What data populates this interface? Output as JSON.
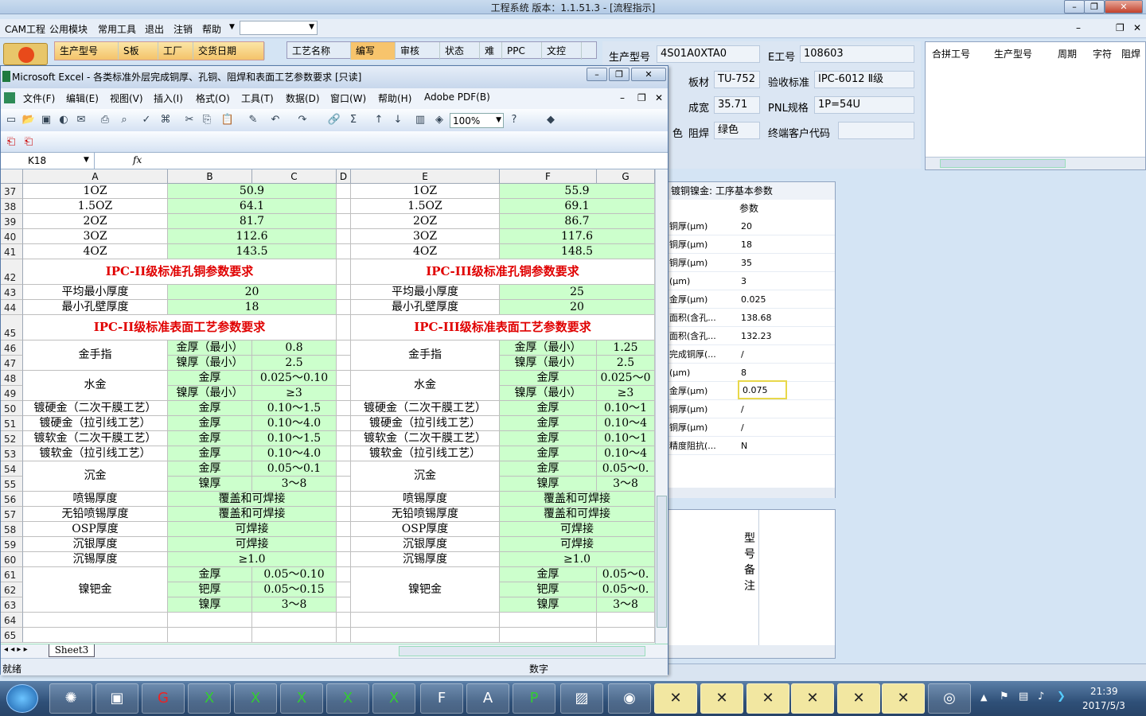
{
  "app": {
    "title": "工程系统   版本：1.1.51.3 - [流程指示]",
    "menu": [
      "CAM工程",
      "公用模块",
      "常用工具",
      "退出",
      "注销",
      "帮助"
    ],
    "tabs_left": [
      "生产型号",
      "S板",
      "工厂",
      "交货日期"
    ],
    "tabs_mid": [
      "工艺名称",
      "编写",
      "审核",
      "状态",
      "难",
      "PPC",
      "文控"
    ]
  },
  "info": {
    "prod_model_label": "生产型号",
    "prod_model": "4S01A0XTA0",
    "e_no_label": "E工号",
    "e_no": "108603",
    "board_label": "板材",
    "board": "TU-752",
    "accept_label": "验收标准",
    "accept": "IPC-6012 Ⅱ级",
    "finish_width_label": "成宽",
    "finish_width": "35.71",
    "pnl_label": "PNL规格",
    "pnl": "1P=54U",
    "color_label": "色",
    "solder_label": "阻焊",
    "solder": "绿色",
    "customer_label": "终端客户代码",
    "customer": ""
  },
  "combo_panel": {
    "headers": [
      "合拼工号",
      "生产型号",
      "周期",
      "字符",
      "阻焊"
    ]
  },
  "process_panel": {
    "title": "镀铜镍金: 工序基本参数",
    "param_header": "参数",
    "rows": [
      {
        "name": "铜厚(μm)",
        "value": "20"
      },
      {
        "name": "铜厚(μm)",
        "value": "18"
      },
      {
        "name": "铜厚(μm)",
        "value": "35"
      },
      {
        "name": "(μm)",
        "value": "3"
      },
      {
        "name": "金厚(μm)",
        "value": "0.025"
      },
      {
        "name": "面积(含孔...",
        "value": "138.68"
      },
      {
        "name": "面积(含孔...",
        "value": "132.23"
      },
      {
        "name": "完成铜厚(...",
        "value": "/"
      },
      {
        "name": "(μm)",
        "value": "8"
      },
      {
        "name": "金厚(μm)",
        "value": "0.075"
      },
      {
        "name": "铜厚(μm)",
        "value": "/"
      },
      {
        "name": "铜厚(μm)",
        "value": "/"
      },
      {
        "name": "精度阻抗(...",
        "value": "N"
      }
    ]
  },
  "remark": {
    "label": "型号备注"
  },
  "excel": {
    "title": "Microsoft Excel - 各类标准外层完成铜厚、孔铜、阻焊和表面工艺参数要求 [只读]",
    "menu": [
      "文件(F)",
      "编辑(E)",
      "视图(V)",
      "插入(I)",
      "格式(O)",
      "工具(T)",
      "数据(D)",
      "窗口(W)",
      "帮助(H)",
      "Adobe PDF(B)"
    ],
    "zoom": "100%",
    "namebox": "K18",
    "fx": "fx",
    "columns": [
      "A",
      "B",
      "C",
      "D",
      "E",
      "F",
      "G"
    ],
    "sheet_tab": "Sheet3",
    "status_left": "就绪",
    "status_right": "数字",
    "rows": [
      {
        "n": "37",
        "l": [
          "1OZ",
          "50.9"
        ],
        "r": [
          "1OZ",
          "55.9"
        ]
      },
      {
        "n": "38",
        "l": [
          "1.5OZ",
          "64.1"
        ],
        "r": [
          "1.5OZ",
          "69.1"
        ]
      },
      {
        "n": "39",
        "l": [
          "2OZ",
          "81.7"
        ],
        "r": [
          "2OZ",
          "86.7"
        ]
      },
      {
        "n": "40",
        "l": [
          "3OZ",
          "112.6"
        ],
        "r": [
          "3OZ",
          "117.6"
        ]
      },
      {
        "n": "41",
        "l": [
          "4OZ",
          "143.5"
        ],
        "r": [
          "4OZ",
          "148.5"
        ]
      }
    ],
    "title42_l": "IPC-II级标准孔铜参数要求",
    "title42_r": "IPC-III级标准孔铜参数要求",
    "r43": {
      "n": "43",
      "l": [
        "平均最小厚度",
        "20"
      ],
      "r": [
        "平均最小厚度",
        "25"
      ]
    },
    "r44": {
      "n": "44",
      "l": [
        "最小孔壁厚度",
        "18"
      ],
      "r": [
        "最小孔壁厚度",
        "20"
      ]
    },
    "title45_l": "IPC-II级标准表面工艺参数要求",
    "title45_r": "IPC-III级标准表面工艺参数要求",
    "gold_finger": "金手指",
    "gold_thick_min": "金厚（最小）",
    "ni_thick_min": "镍厚（最小）",
    "water_gold": "水金",
    "gold_thick": "金厚",
    "ni_thick": "镍厚",
    "pd_thick": "钯厚",
    "l46": "0.8",
    "r46": "1.25",
    "l47": "2.5",
    "r47": "2.5",
    "l48": "0.025～0.10",
    "r48": "0.025～0",
    "l49": "≥3",
    "r49": "≥3",
    "hard1": "镀硬金（二次干膜工艺）",
    "l50": "0.10～1.5",
    "r50": "0.10～1",
    "hard2": "镀硬金（拉引线工艺）",
    "l51": "0.10～4.0",
    "r51": "0.10～4",
    "soft1": "镀软金（二次干膜工艺）",
    "l52": "0.10～1.5",
    "r52": "0.10～1",
    "soft2": "镀软金（拉引线工艺）",
    "l53": "0.10～4.0",
    "r53": "0.10～4",
    "enig": "沉金",
    "l54": "0.05～0.1",
    "r54": "0.05～0.",
    "l55": "3～8",
    "r55": "3～8",
    "hasl": "喷锡厚度",
    "lf_hasl": "无铅喷锡厚度",
    "cover": "覆盖和可焊接",
    "osp": "OSP厚度",
    "silver": "沉银厚度",
    "solderable": "可焊接",
    "tin": "沉锡厚度",
    "tin_val": "≥1.0",
    "enepig": "镍钯金",
    "l61": "0.05～0.10",
    "r61": "0.05～0.",
    "l62": "0.05～0.15",
    "r62": "0.05～0.",
    "l63": "3～8",
    "r63": "3～8",
    "rownums": [
      "42",
      "45",
      "46",
      "47",
      "48",
      "49",
      "50",
      "51",
      "52",
      "53",
      "54",
      "55",
      "56",
      "57",
      "58",
      "59",
      "60",
      "61",
      "62",
      "63",
      "64",
      "65"
    ]
  },
  "taskbar": {
    "time": "21:39",
    "date": "2017/5/3"
  }
}
